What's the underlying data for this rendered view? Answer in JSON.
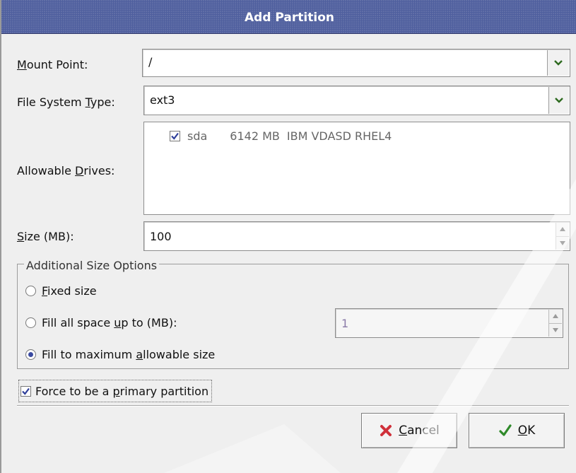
{
  "dialog": {
    "title": "Add Partition"
  },
  "mount_point": {
    "label_pre": "",
    "label_u": "M",
    "label_post": "ount Point:",
    "value": "/"
  },
  "fs_type": {
    "label_pre": "File System ",
    "label_u": "T",
    "label_post": "ype:",
    "value": "ext3"
  },
  "drives": {
    "label_pre": "Allowable ",
    "label_u": "D",
    "label_post": "rives:",
    "items": [
      {
        "checked": true,
        "name": "sda",
        "size": "6142 MB",
        "model": "IBM VDASD RHEL4"
      }
    ]
  },
  "size": {
    "label_pre": "",
    "label_u": "S",
    "label_post": "ize (MB):",
    "value": "100"
  },
  "size_options": {
    "legend": "Additional Size Options",
    "fixed": {
      "pre": "",
      "u": "F",
      "post": "ixed size",
      "selected": false
    },
    "fill_up_to": {
      "pre": "Fill all space ",
      "u": "u",
      "post": "p to (MB):",
      "selected": false,
      "value": "1"
    },
    "fill_max": {
      "pre": "Fill to maximum ",
      "u": "a",
      "post": "llowable size",
      "selected": true
    }
  },
  "force_primary": {
    "pre": "Force to be a ",
    "u": "p",
    "post": "rimary partition",
    "checked": true
  },
  "buttons": {
    "cancel": {
      "u": "C",
      "post": "ancel",
      "icon": "cross-icon"
    },
    "ok": {
      "u": "O",
      "post": "K",
      "icon": "check-icon"
    }
  },
  "colors": {
    "titlebar": "#4f5f9e",
    "check": "#2f3f9a",
    "cancel_icon": "#d0303a",
    "ok_icon": "#2f8a2a"
  }
}
